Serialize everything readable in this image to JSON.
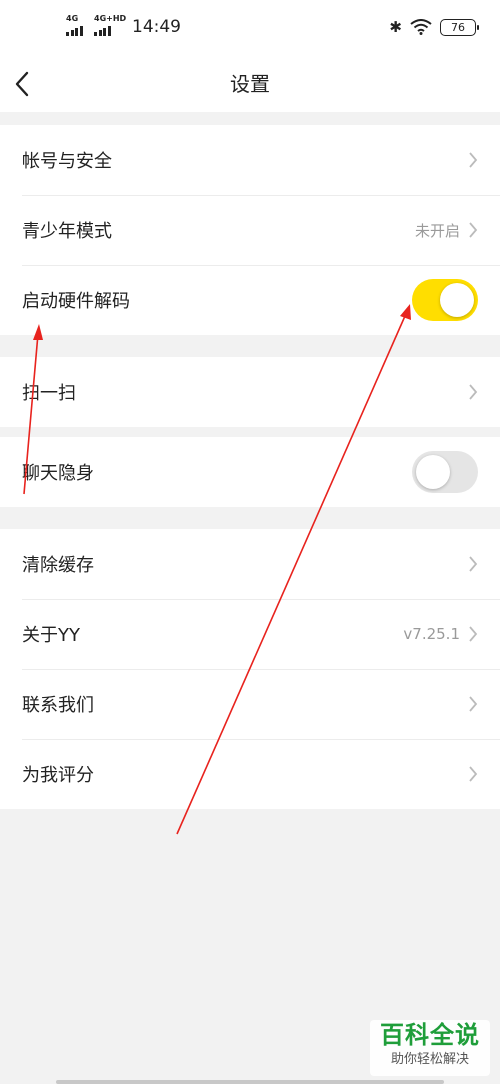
{
  "status_bar": {
    "signal1_label": "4G",
    "signal2_label": "4G+HD",
    "time": "14:49",
    "bluetooth_glyph": "✱",
    "battery": "76"
  },
  "nav": {
    "title": "设置",
    "back_icon": "chevron-left-icon"
  },
  "settings": {
    "group1": [
      {
        "label": "帐号与安全",
        "value": "",
        "control": "chevron"
      },
      {
        "label": "青少年模式",
        "value": "未开启",
        "control": "chevron"
      },
      {
        "label": "启动硬件解码",
        "value": "",
        "control": "toggle",
        "on": true
      }
    ],
    "group2": [
      {
        "label": "扫一扫",
        "value": "",
        "control": "chevron"
      }
    ],
    "group3": [
      {
        "label": "聊天隐身",
        "value": "",
        "control": "toggle",
        "on": false
      }
    ],
    "group4": [
      {
        "label": "清除缓存",
        "value": "",
        "control": "chevron"
      },
      {
        "label": "关于YY",
        "value": "v7.25.1",
        "control": "chevron"
      },
      {
        "label": "联系我们",
        "value": "",
        "control": "chevron"
      },
      {
        "label": "为我评分",
        "value": "",
        "control": "chevron"
      }
    ]
  },
  "colors": {
    "toggle_on": "#ffde00",
    "toggle_off": "#e5e5e5",
    "annotation_arrow": "#e8231e",
    "watermark_green": "#1f9e3a"
  },
  "watermark": {
    "main": "百科全说",
    "sub": "助你轻松解决"
  }
}
